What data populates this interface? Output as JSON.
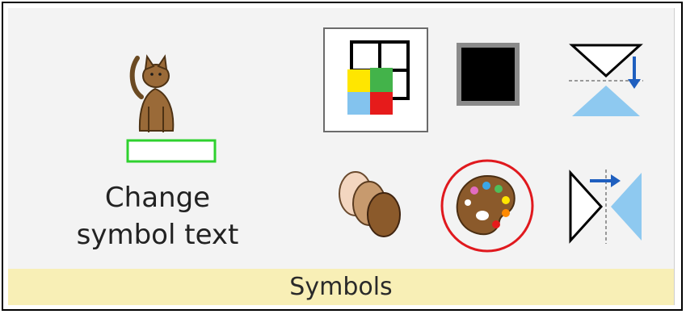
{
  "ribbon_group": {
    "name": "Symbols",
    "buttons": {
      "change_symbol_text": {
        "label_line1": "Change",
        "label_line2": "symbol text",
        "icon": "cat-symbol-icon"
      },
      "grid_color": {
        "icon": "color-grid-icon"
      },
      "border_color": {
        "icon": "black-square-icon"
      },
      "skin_tone": {
        "icon": "skin-tone-icon"
      },
      "color_palette": {
        "icon": "palette-icon"
      },
      "flip_vertical": {
        "icon": "flip-vertical-icon"
      },
      "flip_horizontal": {
        "icon": "flip-horizontal-icon"
      }
    }
  },
  "colors": {
    "label_bar": "#f8efb6",
    "highlight_circle": "#e0191e",
    "flip_blue": "#8ec9f0",
    "text_box_green": "#2ed12e"
  }
}
